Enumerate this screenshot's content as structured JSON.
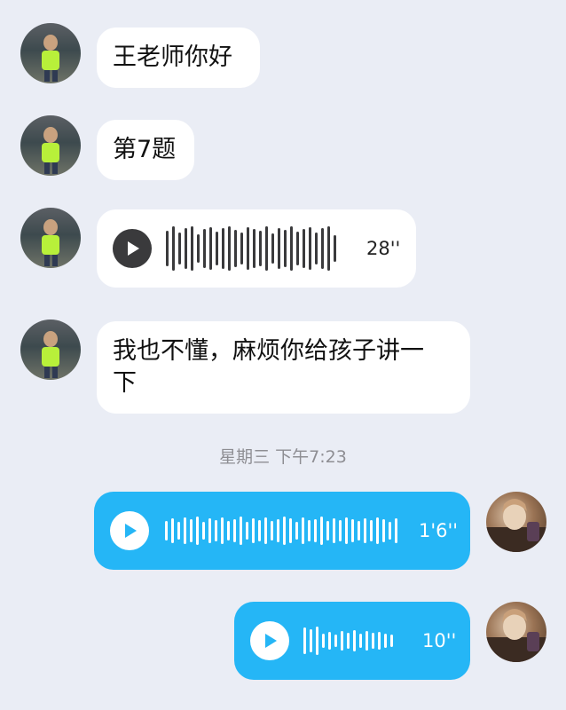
{
  "messages": [
    {
      "type": "text",
      "text": "王老师你好"
    },
    {
      "type": "text",
      "text": "第7题"
    },
    {
      "type": "voice",
      "duration": "28''"
    },
    {
      "type": "text",
      "text": "我也不懂，麻烦你给孩子讲一\n下"
    }
  ],
  "timestamp": "星期三 下午7:23",
  "outgoing": [
    {
      "type": "voice",
      "duration": "1'6''"
    },
    {
      "type": "voice",
      "duration": "10''"
    }
  ],
  "colors": {
    "background": "#eaedf5",
    "incoming_bubble": "#ffffff",
    "outgoing_bubble": "#25b6f6",
    "timestamp": "#8e8e93"
  }
}
